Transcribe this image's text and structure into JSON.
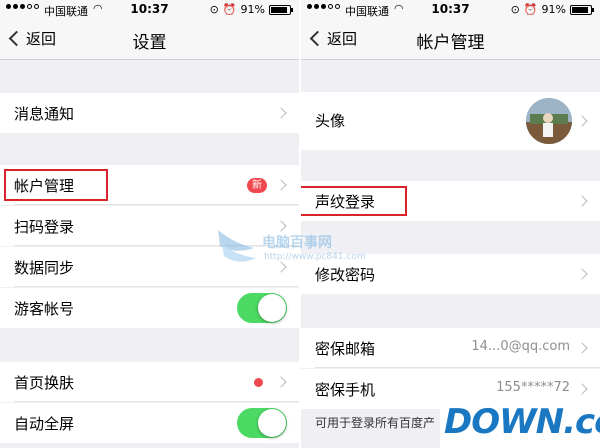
{
  "status_bar": {
    "carrier": "中国联通",
    "time": "10:37",
    "battery": "91%",
    "battery_level": 0.91
  },
  "left": {
    "nav": {
      "back_label": "返回",
      "title": "设置"
    },
    "rows": [
      {
        "label": "消息通知"
      },
      {
        "label": "帐户管理",
        "badge": "新"
      },
      {
        "label": "扫码登录"
      },
      {
        "label": "数据同步"
      },
      {
        "label": "游客帐号",
        "toggle": true
      },
      {
        "label": "首页换肤",
        "dot": true
      },
      {
        "label": "自动全屏",
        "toggle": true
      }
    ]
  },
  "right": {
    "nav": {
      "back_label": "返回",
      "title": "帐户管理"
    },
    "rows": [
      {
        "label": "头像"
      },
      {
        "label": "声纹登录"
      },
      {
        "label": "修改密码"
      },
      {
        "label": "密保邮箱",
        "value": "14...0@qq.com"
      },
      {
        "label": "密保手机",
        "value": "155*****72"
      }
    ],
    "footnote": "可用于登录所有百度产"
  },
  "watermark": {
    "title": "电脑百事网",
    "url": "http://www.pc841.com"
  },
  "logo": {
    "text": "DOWN",
    "suffix": ".cc"
  },
  "colors": {
    "accent_red": "#d9242b",
    "badge_red": "#f0484e",
    "toggle_green": "#4cd964",
    "logo_blue": "#1a78c2"
  }
}
